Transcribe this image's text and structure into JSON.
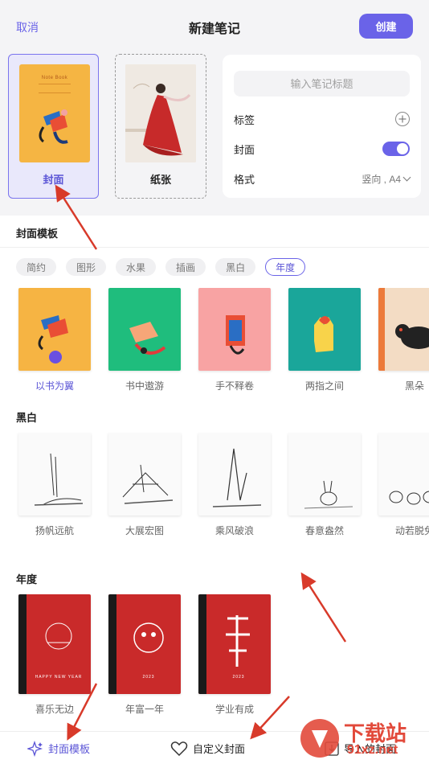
{
  "header": {
    "cancel_label": "取消",
    "title": "新建笔记",
    "create_label": "创建"
  },
  "cards": {
    "cover_label": "封面",
    "paper_label": "纸张",
    "cover_small_text": "Note Book"
  },
  "form": {
    "title_placeholder": "输入笔记标题",
    "tags_label": "标签",
    "cover_label": "封面",
    "format_label": "格式",
    "format_value": "竖向 , A4",
    "cover_toggle_on": true
  },
  "templates": {
    "section_title": "封面模板",
    "chips": [
      "简约",
      "图形",
      "水果",
      "插画",
      "黑白",
      "年度"
    ],
    "active_chip": "年度",
    "row1": [
      {
        "label": "以书为翼",
        "color": "#f6b443",
        "selected": true
      },
      {
        "label": "书中遨游",
        "color": "#1fbd7d",
        "selected": false
      },
      {
        "label": "手不释卷",
        "color": "#f8a3a3",
        "selected": false
      },
      {
        "label": "两指之间",
        "color": "#1aa69a",
        "selected": false
      },
      {
        "label": "黑朵",
        "color": "#f3dcc4",
        "selected": false
      }
    ],
    "bw_title": "黑白",
    "bw_items": [
      "扬帆远航",
      "大展宏图",
      "乘风破浪",
      "春意盎然",
      "动若脱兔"
    ],
    "year_title": "年度",
    "year_items": [
      "喜乐无边",
      "年富一年",
      "学业有成"
    ],
    "year_small_texts": [
      "HAPPY NEW YEAR",
      "2023",
      "2023"
    ]
  },
  "bottom": {
    "tab1": "封面模板",
    "tab2": "自定义封面",
    "tab3": "导入的封面"
  },
  "watermark": {
    "brand": "下载站",
    "url": "91xz.net"
  },
  "colors": {
    "accent": "#6a63e8",
    "header_bg": "#f4f4f6"
  }
}
